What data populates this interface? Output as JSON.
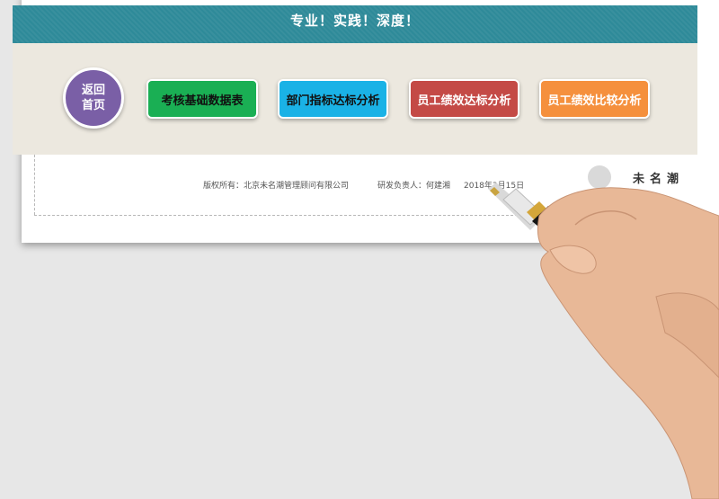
{
  "header": {
    "tagline": "专业！实践！深度！"
  },
  "nav": {
    "home_label": "返回首页",
    "buttons": [
      {
        "label": "考核基础数据表",
        "color": "#1aaf54"
      },
      {
        "label": "部门指标达标分析",
        "color": "#1ab2e6"
      },
      {
        "label": "员工绩效达标分析",
        "color": "#c44a46"
      },
      {
        "label": "员工绩效比较分析",
        "color": "#f5903d"
      }
    ]
  },
  "footer": {
    "copyright": "版权所有：北京未名潮管理顾问有限公司",
    "owner": "研发负责人：何建湘",
    "date": "2018年3月15日",
    "brand": "未名潮"
  },
  "colors": {
    "header_band": "#2e8a99",
    "nav_band": "#ece8df",
    "home_button": "#7a5fa6"
  }
}
